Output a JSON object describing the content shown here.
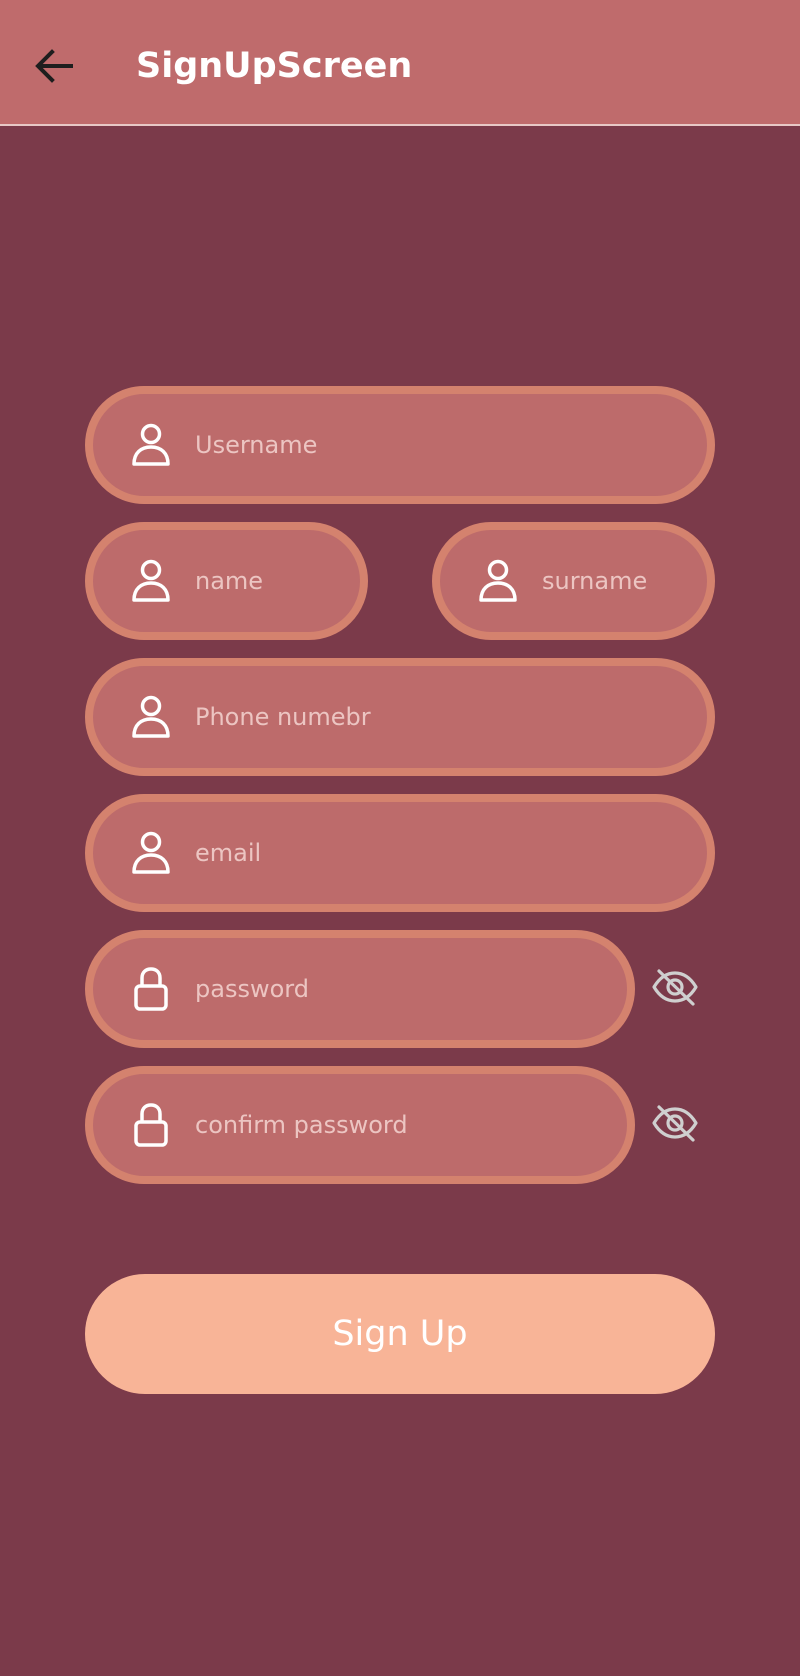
{
  "appbar": {
    "title": "SignUpScreen",
    "back_icon": "arrow-left-icon"
  },
  "form": {
    "username_placeholder": "Username",
    "name_placeholder": "name",
    "surname_placeholder": "surname",
    "phone_placeholder": "Phone numebr",
    "email_placeholder": "email",
    "password_placeholder": "password",
    "confirm_password_placeholder": "confirm password",
    "person_icon": "person-icon",
    "lock_icon": "lock-icon",
    "visibility_icon": "eye-off-icon"
  },
  "actions": {
    "signup_label": "Sign Up"
  },
  "colors": {
    "appbar": "#bf6b6c",
    "background": "#7b3a4a",
    "field_fill": "#bd6b6b",
    "field_border": "#d4826e",
    "button": "#f8b497"
  }
}
